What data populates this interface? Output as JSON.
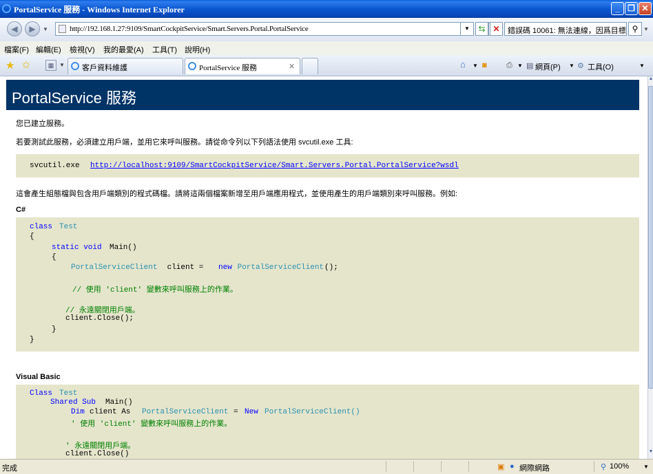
{
  "window": {
    "title": "PortalService 服務 - Windows Internet Explorer"
  },
  "address": {
    "url": "http://192.168.1.27:9109/SmartCockpitService/Smart.Servers.Portal.PortalService"
  },
  "search": {
    "value": "錯誤碼 10061: 無法連線，因爲目標"
  },
  "menu": [
    "檔案(F)",
    "編輯(E)",
    "檢視(V)",
    "我的最愛(A)",
    "工具(T)",
    "說明(H)"
  ],
  "tabs": [
    {
      "label": "客戶資料維護"
    },
    {
      "label": "PortalService 服務"
    }
  ],
  "commands": {
    "page": "網頁(P)",
    "tools": "工具(O)"
  },
  "page": {
    "heading": "PortalService 服務",
    "created": "您已建立服務。",
    "instructions": "若要測試此服務，必須建立用戶端，並用它來呼叫服務。請從命令列以下列語法使用 svcutil.exe 工具:",
    "svcutil_cmd": "svcutil.exe",
    "svcutil_link": "http://localhost:9109/SmartCockpitService/Smart.Servers.Portal.PortalService?wsdl",
    "generate": "這會產生組態檔與包含用戶端類別的程式碼檔。請將這兩個檔案新增至用戶端應用程式，並使用產生的用戶端類別來呼叫服務。例如:",
    "csharp_label": "C#",
    "vb_label": "Visual Basic",
    "cs": {
      "class_kw": "class",
      "class_name": "Test",
      "open": "{",
      "static_void": "static void",
      "main": "Main()",
      "open2": "{",
      "client_type": "PortalServiceClient",
      "client_decl": " client = ",
      "new_kw": "new",
      "client_ctor": " PortalServiceClient",
      "ctor_end": "();",
      "comment1": "// 使用 'client' 變數來呼叫服務上的作業。",
      "comment2": "// 永遠關閉用戶端。",
      "close": "client.Close();",
      "close2": "}",
      "close1": "}"
    },
    "vb": {
      "class_kw": "Class",
      "class_name": "Test",
      "shared_sub": "Shared Sub",
      "main": "Main()",
      "dim": "Dim",
      "client_as": "client As",
      "client_type": "PortalServiceClient",
      "eq": "=",
      "new_kw": "New",
      "client_ctor": "PortalServiceClient()",
      "comment1": "' 使用 'client' 變數來呼叫服務上的作業。",
      "comment2": "' 永遠關閉用戶端。",
      "close": "client.Close()"
    }
  },
  "status": {
    "left": "完成",
    "zone": "網際網路",
    "zoom": "100%"
  },
  "colors": {
    "header_bg": "#003366",
    "code_bg": "#e5e5cc",
    "keyword": "#0000ff",
    "type": "#2b91af",
    "comment": "#008000"
  }
}
